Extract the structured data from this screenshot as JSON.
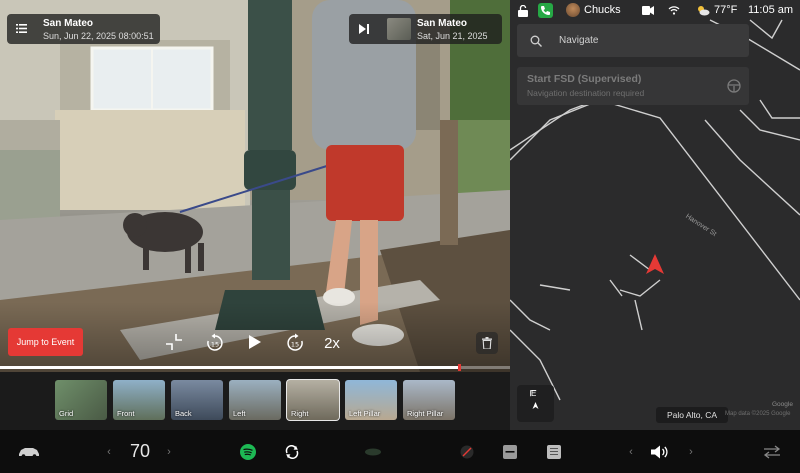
{
  "viewer": {
    "location": {
      "city": "San Mateo",
      "timestamp": "Sun, Jun 22, 2025 08:00:51"
    },
    "next_clip": {
      "city": "San Mateo",
      "date": "Sat, Jun 21, 2025"
    },
    "jump_label": "Jump to Event",
    "speed_label": "2x",
    "progress_fraction": 0.9,
    "cameras": [
      {
        "label": "Grid",
        "selected": false
      },
      {
        "label": "Front",
        "selected": false
      },
      {
        "label": "Back",
        "selected": false
      },
      {
        "label": "Left",
        "selected": false
      },
      {
        "label": "Right",
        "selected": true
      },
      {
        "label": "Left Pillar",
        "selected": false
      },
      {
        "label": "Right Pillar",
        "selected": false
      }
    ]
  },
  "status": {
    "profile_name": "Chucks",
    "temperature": "77°F",
    "time": "11:05 am"
  },
  "map": {
    "search_placeholder": "Navigate",
    "fsd_title": "Start FSD (Supervised)",
    "fsd_subtitle": "Navigation destination required",
    "street_name": "Hanover St",
    "compass_letter": "E",
    "location_label": "Palo Alto, CA",
    "attribution": "Google",
    "attribution_sub": "Map data ©2025 Google"
  },
  "taskbar": {
    "cabin_temp": "70"
  },
  "colors": {
    "accent_red": "#e53935",
    "phone_green": "#26a845",
    "spotify_green": "#1db954"
  }
}
